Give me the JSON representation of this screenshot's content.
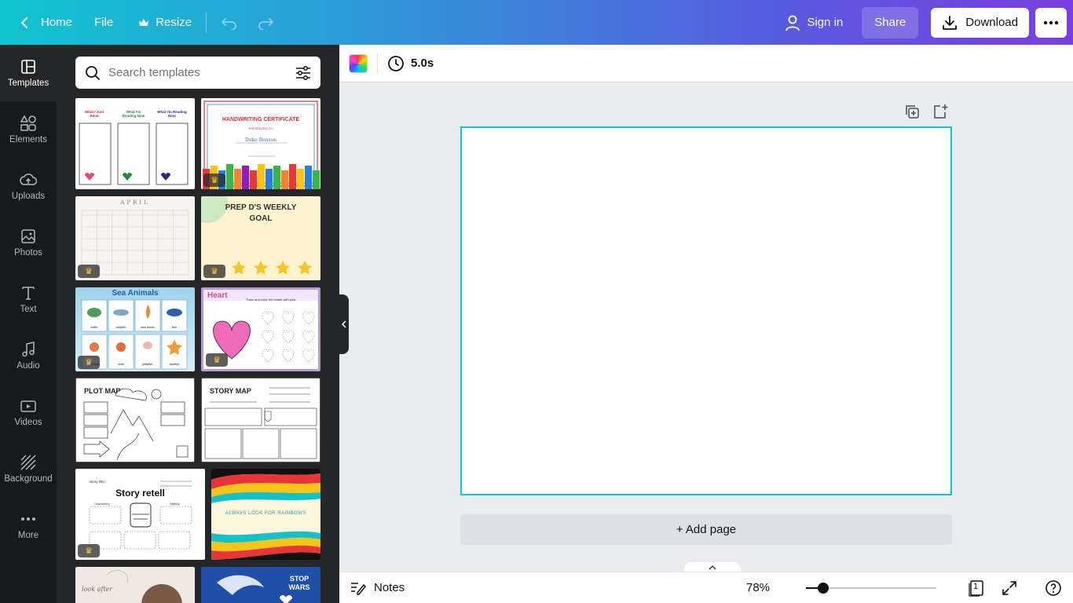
{
  "topbar": {
    "home_label": "Home",
    "file_label": "File",
    "resize_label": "Resize",
    "sign_in_label": "Sign in",
    "share_label": "Share",
    "download_label": "Download"
  },
  "rail": {
    "items": [
      {
        "label": "Templates",
        "icon": "templates-icon",
        "active": true
      },
      {
        "label": "Elements",
        "icon": "elements-icon"
      },
      {
        "label": "Uploads",
        "icon": "upload-cloud-icon"
      },
      {
        "label": "Photos",
        "icon": "photo-icon"
      },
      {
        "label": "Text",
        "icon": "text-icon"
      },
      {
        "label": "Audio",
        "icon": "music-note-icon"
      },
      {
        "label": "Videos",
        "icon": "video-icon"
      },
      {
        "label": "Background",
        "icon": "background-hatch-icon"
      },
      {
        "label": "More",
        "icon": "more-dots-icon"
      }
    ]
  },
  "search": {
    "placeholder": "Search templates"
  },
  "templates": [
    {
      "id": "reading-log",
      "premium": false,
      "text_a": "What I Just Read",
      "text_b": "What I'm Reading Now",
      "text_c": "What I'm Reading Next"
    },
    {
      "id": "handwriting-certificate",
      "premium": true,
      "title": "HANDWRITING CERTIFICATE",
      "presented": "PRESENTED TO",
      "name": "Duke Benson"
    },
    {
      "id": "april-calendar",
      "premium": true,
      "title": "APRIL"
    },
    {
      "id": "weekly-goal",
      "premium": true,
      "title": "PREP D'S WEEKLY GOAL"
    },
    {
      "id": "sea-animals",
      "premium": true,
      "title": "Sea Animals",
      "labels": [
        "turtle",
        "dolphin",
        "sea horse",
        "fish",
        "octopus",
        "crab",
        "jellyfish",
        "starfish"
      ]
    },
    {
      "id": "heart-tracing",
      "premium": true,
      "title": "Heart",
      "subtitle": "Trace and color the hearts with pink."
    },
    {
      "id": "plot-map",
      "premium": false,
      "title": "PLOT MAP"
    },
    {
      "id": "story-map",
      "premium": false,
      "title": "STORY MAP"
    },
    {
      "id": "story-retell",
      "premium": true,
      "title": "Story retell",
      "story_title": "Story title:",
      "characters": "Characters",
      "setting": "Setting"
    },
    {
      "id": "rainbows",
      "premium": false,
      "title": "ALWAYS LOOK FOR RAINBOWS"
    },
    {
      "id": "look-after",
      "premium": false,
      "title": "look after"
    },
    {
      "id": "stop-wars",
      "premium": false,
      "title": "STOP WARS"
    }
  ],
  "editor": {
    "duration": "5.0s",
    "add_page_label": "+ Add page",
    "notes_label": "Notes",
    "zoom_value": "78%",
    "zoom_fraction": 0.13,
    "page_count": "1",
    "canvas_border_color": "#11c4d6"
  },
  "colors": {
    "gradient_start": "#10c4d0",
    "gradient_end": "#7a3fe0",
    "rail_bg": "#18191b",
    "panel_bg": "#252627"
  }
}
